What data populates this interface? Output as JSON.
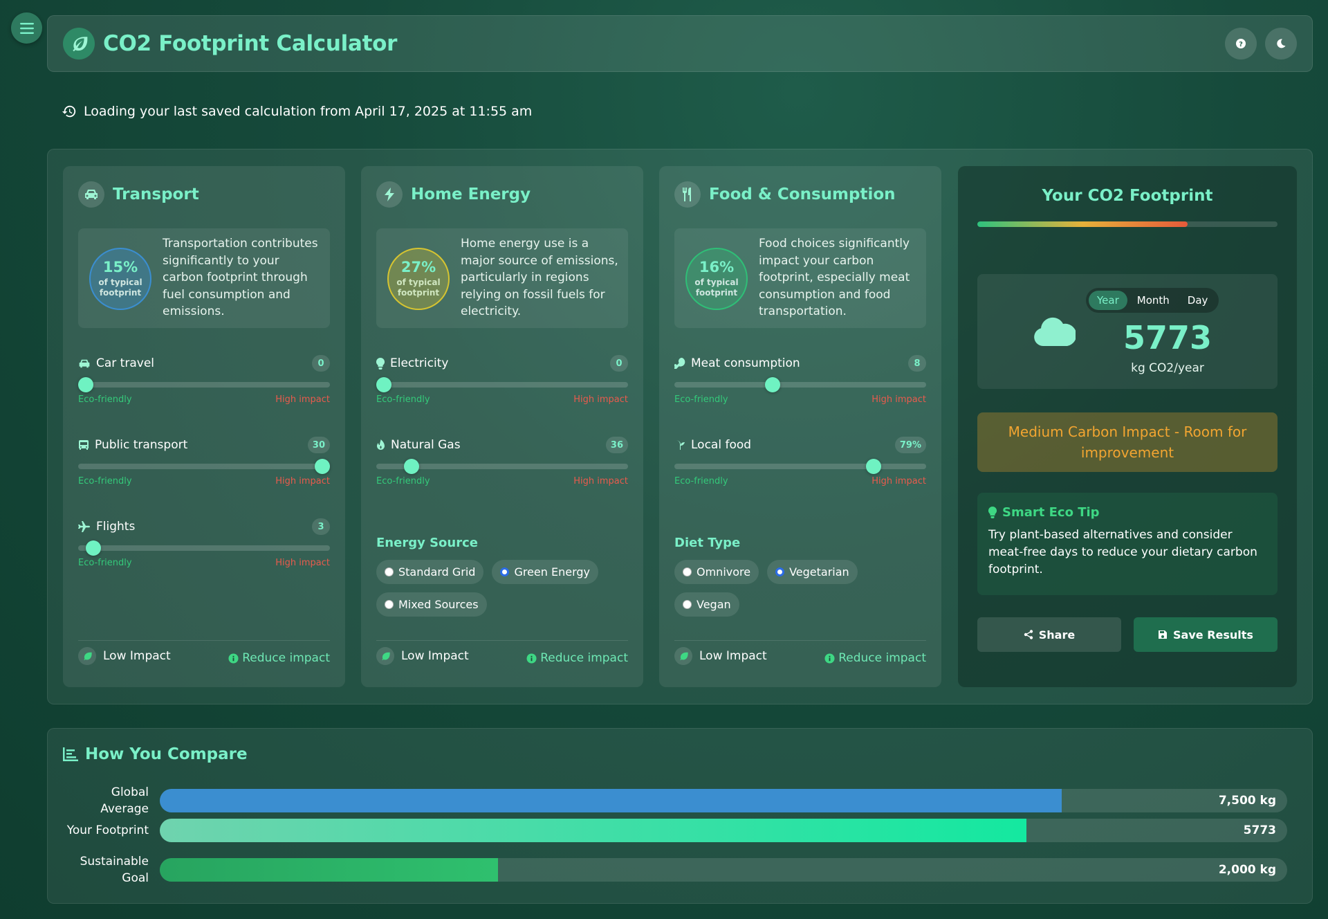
{
  "header": {
    "title": "CO2 Footprint Calculator"
  },
  "status": {
    "loading_text": "Loading your last saved calculation from April 17, 2025 at 11:55 am"
  },
  "slider_scale": {
    "eco": "Eco-friendly",
    "high": "High impact"
  },
  "cards": {
    "transport": {
      "title": "Transport",
      "pct": "15%",
      "pct_sub": "of typical footprint",
      "description": "Transportation contributes significantly to your carbon footprint through fuel consumption and emissions.",
      "sliders": [
        {
          "label": "Car travel",
          "value": "0",
          "position": 0.0
        },
        {
          "label": "Public transport",
          "value": "30",
          "position": 0.97
        },
        {
          "label": "Flights",
          "value": "3",
          "position": 0.06
        }
      ],
      "impact": "Low Impact",
      "reduce": "Reduce impact"
    },
    "home": {
      "title": "Home Energy",
      "pct": "27%",
      "pct_sub": "of typical footprint",
      "description": "Home energy use is a major source of emissions, particularly in regions relying on fossil fuels for electricity.",
      "sliders": [
        {
          "label": "Electricity",
          "value": "0",
          "position": 0.0
        },
        {
          "label": "Natural Gas",
          "value": "36",
          "position": 0.14
        }
      ],
      "source_title": "Energy Source",
      "options": [
        {
          "label": "Standard Grid",
          "checked": false
        },
        {
          "label": "Green Energy",
          "checked": true
        },
        {
          "label": "Mixed Sources",
          "checked": false
        }
      ],
      "impact": "Low Impact",
      "reduce": "Reduce impact"
    },
    "food": {
      "title": "Food & Consumption",
      "pct": "16%",
      "pct_sub": "of typical footprint",
      "description": "Food choices significantly impact your carbon footprint, especially meat consumption and food transportation.",
      "sliders": [
        {
          "label": "Meat consumption",
          "value": "8",
          "position": 0.39
        },
        {
          "label": "Local food",
          "value": "79%",
          "position": 0.79
        }
      ],
      "diet_title": "Diet Type",
      "options": [
        {
          "label": "Omnivore",
          "checked": false
        },
        {
          "label": "Vegetarian",
          "checked": true
        },
        {
          "label": "Vegan",
          "checked": false
        }
      ],
      "impact": "Low Impact",
      "reduce": "Reduce impact"
    }
  },
  "result": {
    "title": "Your CO2 Footprint",
    "gauge_level": 0.7,
    "tabs": [
      "Year",
      "Month",
      "Day"
    ],
    "active_tab": "Year",
    "value": "5773",
    "unit": "kg CO2/year",
    "impact_message": "Medium Carbon Impact - Room for improvement",
    "tip_title": "Smart Eco Tip",
    "tip_text": "Try plant-based alternatives and consider meat-free days to reduce your dietary carbon footprint.",
    "share_label": "Share",
    "save_label": "Save Results"
  },
  "compare": {
    "title": "How You Compare",
    "rows": [
      {
        "label": "Global Average",
        "value_label": "7,500 kg",
        "level": 0.8,
        "color": "#3b8ed0"
      },
      {
        "label": "Your Footprint",
        "value_label": "5773",
        "level": 0.769,
        "color": "linear-gradient(90deg,#6fd3ae,#14e8a0)"
      },
      {
        "label": "Sustainable Goal",
        "value_label": "2,000 kg",
        "level": 0.3,
        "color": "linear-gradient(90deg,#27a45f,#2fc06e)"
      }
    ]
  },
  "colors": {
    "accent": "#7af0c8",
    "transport_circle": "#3b8ed0",
    "home_circle": "#d6c431",
    "food_circle": "#2fbf77",
    "eco": "#34c97a",
    "high": "#e85b4d",
    "warning": "#f2a531"
  }
}
